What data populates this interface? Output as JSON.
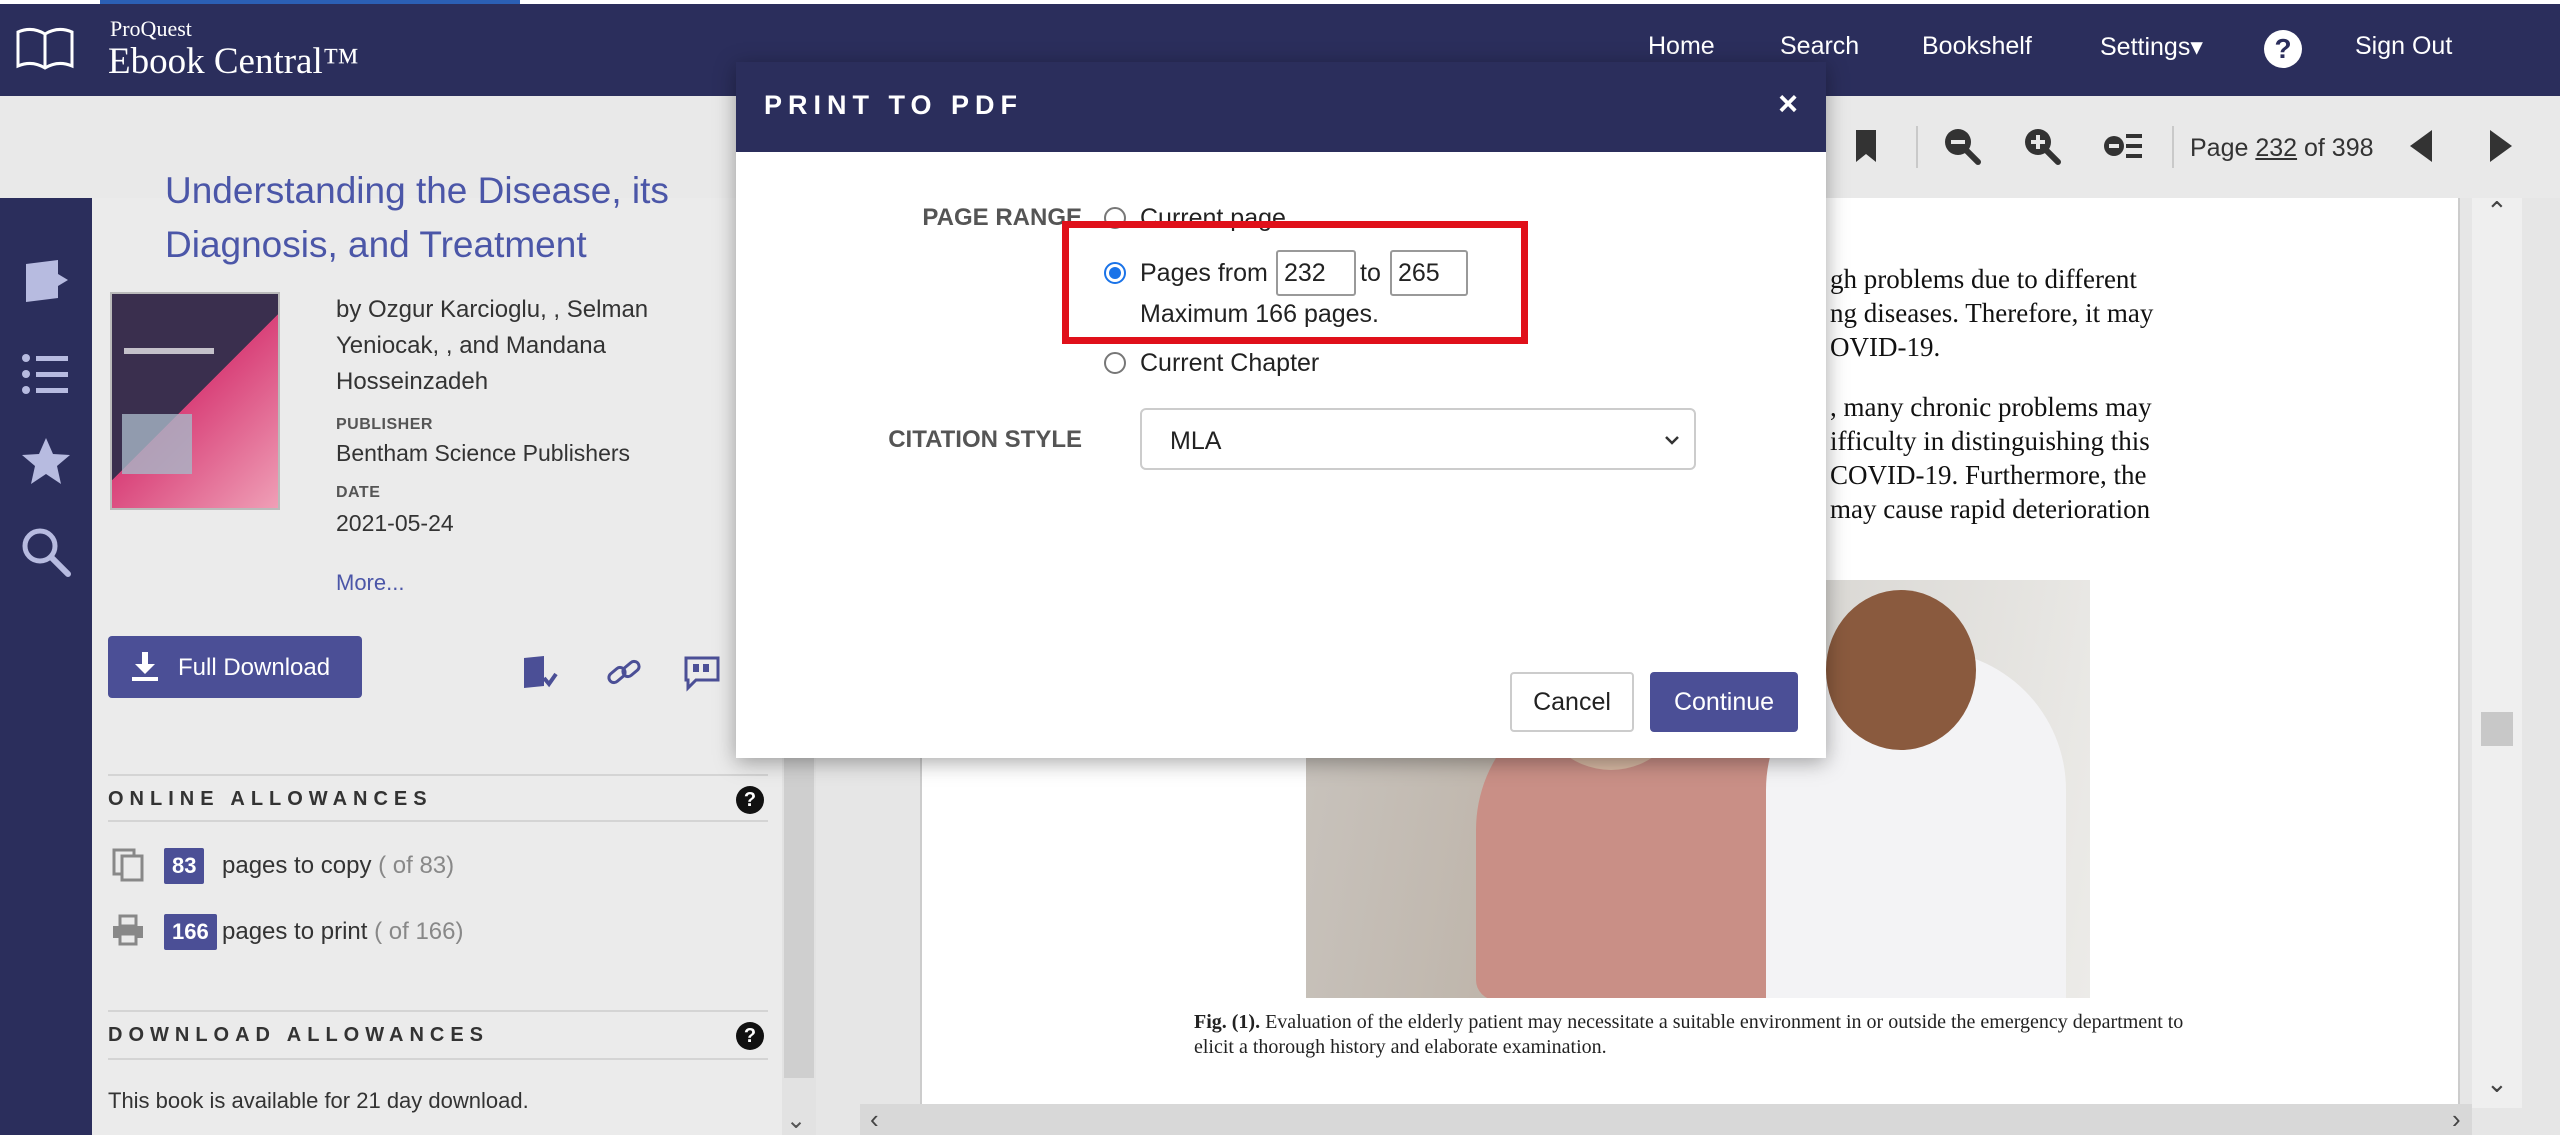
{
  "nav": {
    "brand_small": "ProQuest",
    "brand_big": "Ebook Central™",
    "links": [
      "Home",
      "Search",
      "Bookshelf",
      "Settings▾",
      "Sign Out"
    ],
    "help": "?"
  },
  "toolbar": {
    "page_label": "Page",
    "page_number": "232",
    "page_of": "of 398"
  },
  "book": {
    "title_clip": "Understanding the Disease, its",
    "title": "Diagnosis, and Treatment",
    "authors": "by Ozgur Karcioglu, , Selman Yeniocak, , and Mandana Hosseinzadeh",
    "publisher_label": "PUBLISHER",
    "publisher": "Bentham Science Publishers",
    "date_label": "DATE",
    "date": "2021-05-24",
    "more": "More...",
    "full_download": "Full Download"
  },
  "allowances": {
    "online_head": "ONLINE ALLOWANCES",
    "copy_count": "83",
    "copy_text": "pages to copy",
    "copy_total": "( of 83)",
    "print_count": "166",
    "print_text": "pages to print",
    "print_total": "( of 166)",
    "download_head": "DOWNLOAD ALLOWANCES",
    "download_note": "This book is available for 21 day download."
  },
  "document": {
    "lines_block1": [
      "gh problems due to different",
      "ng diseases. Therefore, it may",
      "OVID-19."
    ],
    "lines_block2": [
      ", many chronic problems may",
      "ifficulty in distinguishing this",
      "COVID-19. Furthermore, the",
      "may cause rapid deterioration"
    ],
    "caption_label": "Fig. (1).",
    "caption_text": "Evaluation of the elderly patient may necessitate a suitable environment in or outside the emergency department to elicit a thorough history and elaborate examination."
  },
  "modal": {
    "title": "PRINT TO PDF",
    "close": "×",
    "page_range_label": "PAGE RANGE",
    "opt_current_page": "Current page",
    "opt_pages_from": "Pages from",
    "from_value": "232",
    "to_label": "to",
    "to_value": "265",
    "max_note": "Maximum 166 pages.",
    "opt_current_chapter": "Current Chapter",
    "citation_label": "CITATION STYLE",
    "citation_value": "MLA",
    "cancel": "Cancel",
    "continue": "Continue",
    "selected_option": "pages_from"
  },
  "colors": {
    "navy": "#2b2e5c",
    "accent": "#4b4f96",
    "highlight": "#e0101a"
  }
}
